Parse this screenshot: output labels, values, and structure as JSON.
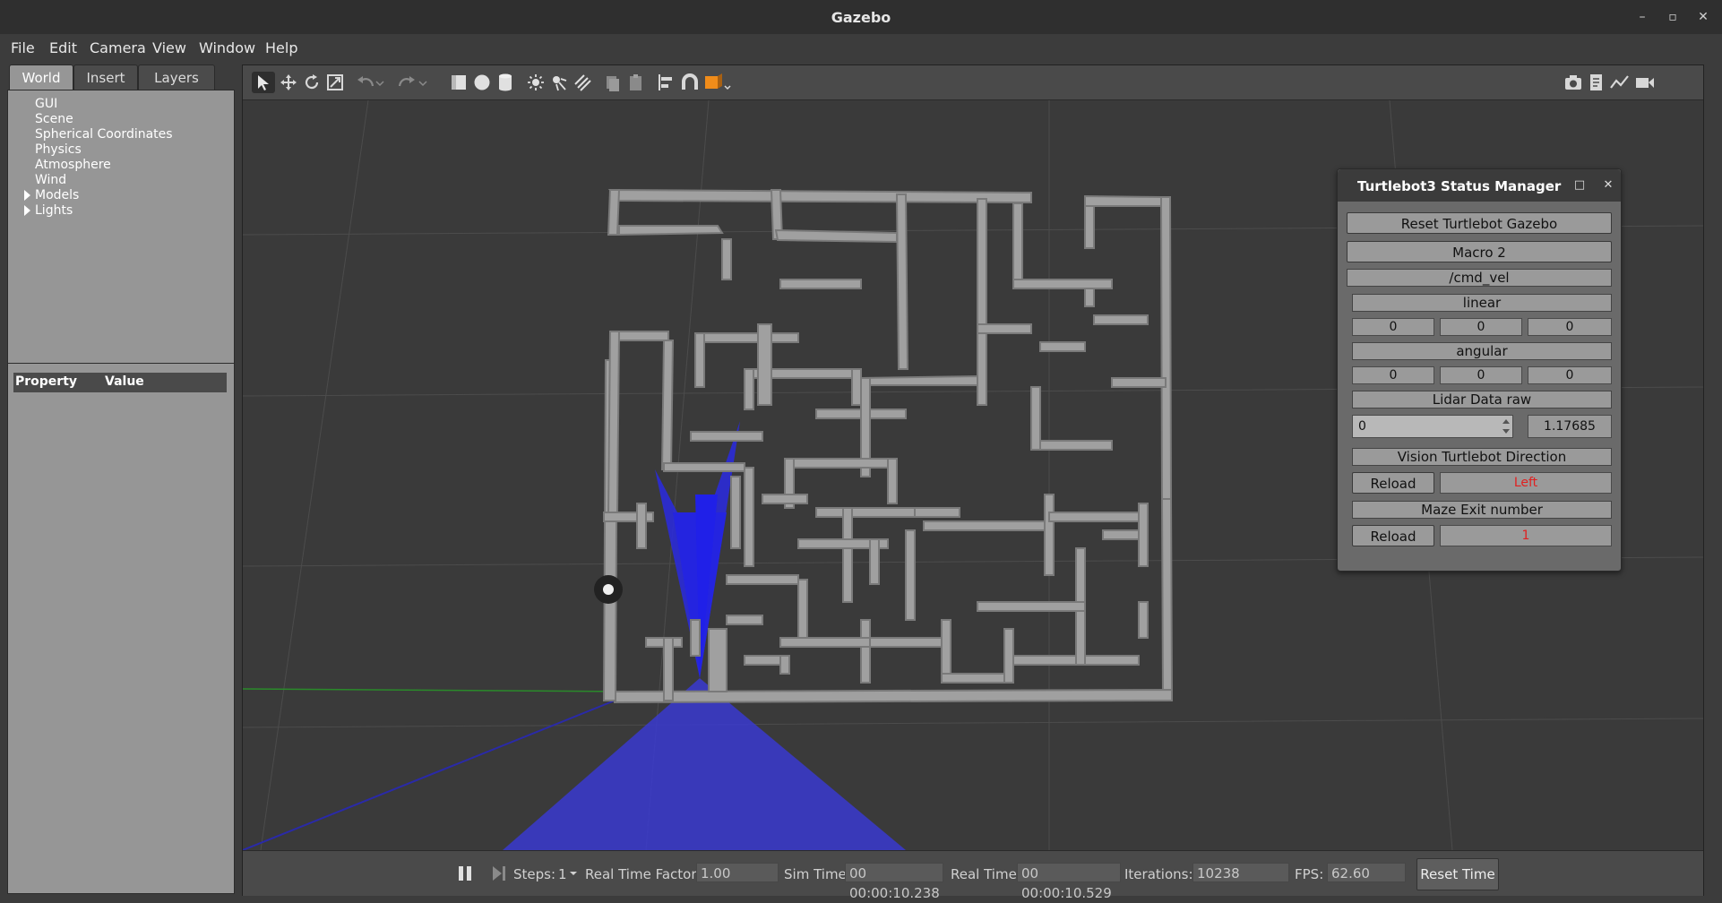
{
  "window": {
    "title": "Gazebo"
  },
  "menu": [
    "File",
    "Edit",
    "Camera",
    "View",
    "Window",
    "Help"
  ],
  "left_panel": {
    "tabs": [
      "World",
      "Insert",
      "Layers"
    ],
    "tree": [
      "GUI",
      "Scene",
      "Spherical Coordinates",
      "Physics",
      "Atmosphere",
      "Wind",
      "Models",
      "Lights"
    ],
    "property_header": {
      "property": "Property",
      "value": "Value"
    }
  },
  "toolbar": {
    "icons": [
      "select-icon",
      "translate-icon",
      "rotate-icon",
      "scale-icon",
      "undo-icon",
      "redo-icon",
      "box-icon",
      "sphere-icon",
      "cylinder-icon",
      "point-light-icon",
      "spot-light-icon",
      "directional-light-icon",
      "copy-icon",
      "paste-icon",
      "align-icon",
      "snap-icon",
      "view-angle-icon",
      "screenshot-icon",
      "log-icon",
      "plot-icon",
      "record-icon"
    ]
  },
  "status_manager": {
    "title": "Turtlebot3 Status Manager",
    "reset_button": "Reset Turtlebot Gazebo",
    "macro_button": "Macro 2",
    "cmd_vel_label": "/cmd_vel",
    "linear_label": "linear",
    "linear_values": [
      "0",
      "0",
      "0"
    ],
    "angular_label": "angular",
    "angular_values": [
      "0",
      "0",
      "0"
    ],
    "lidar_label": "Lidar Data raw",
    "lidar_index": "0",
    "lidar_value": "1.17685",
    "vision_label": "Vision Turtlebot Direction",
    "vision_reload": "Reload",
    "vision_value": "Left",
    "maze_label": "Maze Exit number",
    "maze_reload": "Reload",
    "maze_value": "1"
  },
  "bottom_bar": {
    "steps_label": "Steps:",
    "steps_value": "1",
    "rtf_label": "Real Time Factor:",
    "rtf_value": "1.00",
    "sim_time_label": "Sim Time:",
    "sim_time_value": "00 00:00:10.238",
    "real_time_label": "Real Time:",
    "real_time_value": "00 00:00:10.529",
    "iterations_label": "Iterations:",
    "iterations_value": "10238",
    "fps_label": "FPS:",
    "fps_value": "62.60",
    "reset_time": "Reset Time"
  }
}
